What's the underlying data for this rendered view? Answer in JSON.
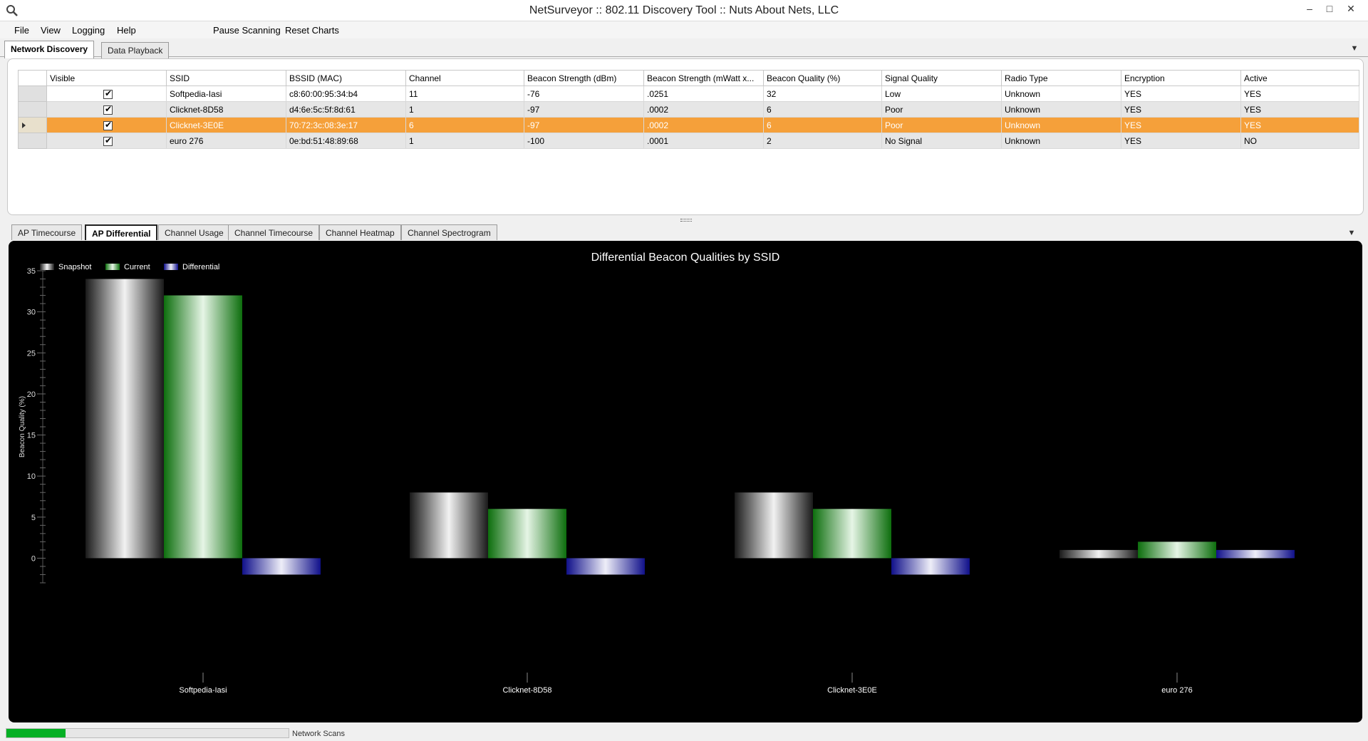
{
  "window": {
    "title": "NetSurveyor :: 802.11 Discovery Tool :: Nuts About Nets, LLC",
    "app_icon": "magnifier-icon",
    "controls": [
      "minimize-icon",
      "maximize-icon",
      "close-icon"
    ]
  },
  "menu": {
    "file": "File",
    "view": "View",
    "logging": "Logging",
    "help": "Help",
    "pause_scanning": "Pause Scanning",
    "reset_charts": "Reset Charts"
  },
  "top_tabs": [
    "Network Discovery",
    "Data Playback"
  ],
  "grid": {
    "columns": [
      "Visible",
      "SSID",
      "BSSID (MAC)",
      "Channel",
      "Beacon Strength (dBm)",
      "Beacon Strength (mWatt x...",
      "Beacon Quality (%)",
      "Signal Quality",
      "Radio Type",
      "Encryption",
      "Active"
    ],
    "rows": [
      {
        "visible": true,
        "ssid": "Softpedia-Iasi",
        "bssid": "c8:60:00:95:34:b4",
        "channel": "11",
        "dbm": "-76",
        "mwatt": ".0251",
        "quality": "32",
        "signal": "Low",
        "radio": "Unknown",
        "encryption": "YES",
        "active": "YES"
      },
      {
        "visible": true,
        "ssid": "Clicknet-8D58",
        "bssid": "d4:6e:5c:5f:8d:61",
        "channel": "1",
        "dbm": "-97",
        "mwatt": ".0002",
        "quality": "6",
        "signal": "Poor",
        "radio": "Unknown",
        "encryption": "YES",
        "active": "YES"
      },
      {
        "visible": true,
        "ssid": "Clicknet-3E0E",
        "bssid": "70:72:3c:08:3e:17",
        "channel": "6",
        "dbm": "-97",
        "mwatt": ".0002",
        "quality": "6",
        "signal": "Poor",
        "radio": "Unknown",
        "encryption": "YES",
        "active": "YES"
      },
      {
        "visible": true,
        "ssid": "euro 276",
        "bssid": "0e:bd:51:48:89:68",
        "channel": "1",
        "dbm": "-100",
        "mwatt": ".0001",
        "quality": "2",
        "signal": "No Signal",
        "radio": "Unknown",
        "encryption": "YES",
        "active": "NO"
      }
    ],
    "selected_row": 2
  },
  "bottom_tabs": [
    "AP Timecourse",
    "AP Differential",
    "Channel Usage",
    "Channel Timecourse",
    "Channel Heatmap",
    "Channel Spectrogram"
  ],
  "chart_data": {
    "type": "bar",
    "title": "Differential Beacon Qualities by SSID",
    "xlabel": "",
    "ylabel": "Beacon Quality (%)",
    "ylim": [
      -3,
      35
    ],
    "yticks": [
      0,
      5,
      10,
      15,
      20,
      25,
      30,
      35
    ],
    "grid": false,
    "legend_position": "top-left",
    "categories": [
      "Softpedia-Iasi",
      "Clicknet-8D58",
      "Clicknet-3E0E",
      "euro 276"
    ],
    "series": [
      {
        "name": "Snapshot",
        "values": [
          34,
          8,
          8,
          1
        ],
        "color": "#ffffff"
      },
      {
        "name": "Current",
        "values": [
          32,
          6,
          6,
          2
        ],
        "color": "#1aa01a"
      },
      {
        "name": "Differential",
        "values": [
          -2,
          -2,
          -2,
          1
        ],
        "color": "#1a1aa8"
      }
    ]
  },
  "status": {
    "label": "Network Scans",
    "progress": 0.21,
    "progress_color": "#06b025",
    "selected_row_color": "#f5a03a"
  }
}
